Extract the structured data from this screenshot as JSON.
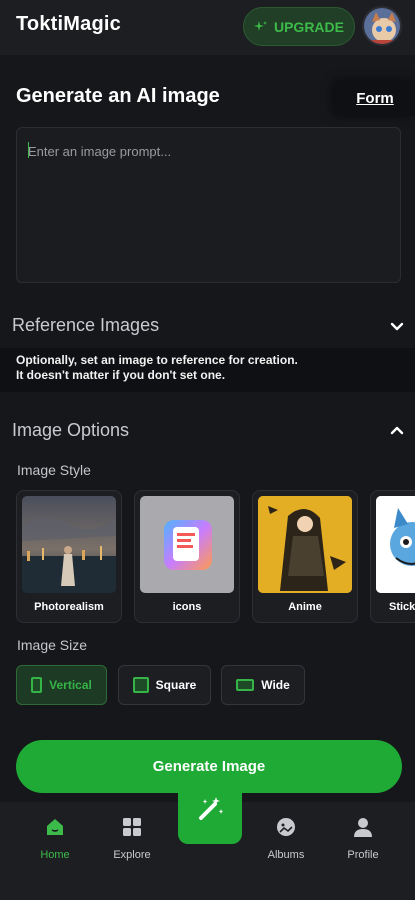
{
  "header": {
    "app_title": "ToktiMagic",
    "upgrade_label": "UPGRADE"
  },
  "generate": {
    "heading": "Generate an AI image",
    "form_link": "Form",
    "prompt_placeholder": "Enter an image prompt..."
  },
  "reference": {
    "title": "Reference Images",
    "note_line1": "Optionally, set an image to reference for creation.",
    "note_line2": "It doesn't matter if you don't set one."
  },
  "options": {
    "title": "Image Options",
    "style_label": "Image Style",
    "styles": [
      "Photorealism",
      "icons",
      "Anime",
      "Sticker"
    ],
    "size_label": "Image Size",
    "sizes": [
      "Vertical",
      "Square",
      "Wide"
    ],
    "selected_size": "Vertical"
  },
  "generate_button": "Generate Image",
  "nav": {
    "items": [
      "Home",
      "Explore",
      "Albums",
      "Profile"
    ],
    "active": "Home"
  },
  "colors": {
    "accent": "#1faa36",
    "accent_text": "#3dbb4a",
    "background": "#16171b"
  }
}
